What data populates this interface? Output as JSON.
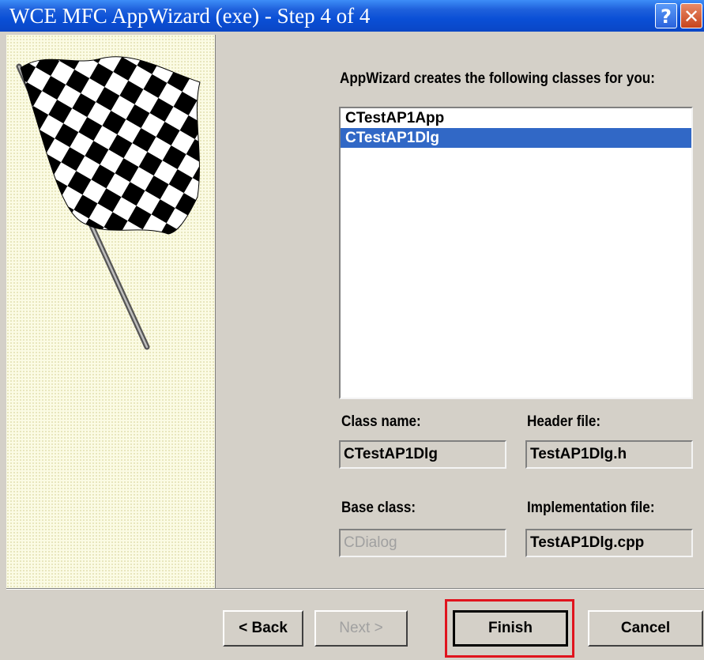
{
  "window": {
    "title": "WCE MFC AppWizard (exe) - Step 4 of 4",
    "help_glyph": "?",
    "close_glyph": "✕"
  },
  "classes": {
    "heading": "AppWizard creates the following classes for you:",
    "items": [
      {
        "label": "CTestAP1App",
        "selected": false
      },
      {
        "label": "CTestAP1Dlg",
        "selected": true
      }
    ]
  },
  "fields": {
    "class_name_label": "Class name:",
    "class_name_value": "CTestAP1Dlg",
    "header_file_label": "Header file:",
    "header_file_value": "TestAP1Dlg.h",
    "base_class_label": "Base class:",
    "base_class_value": "CDialog",
    "impl_file_label": "Implementation file:",
    "impl_file_value": "TestAP1Dlg.cpp"
  },
  "buttons": {
    "back": "< Back",
    "next": "Next >",
    "finish": "Finish",
    "cancel": "Cancel"
  },
  "colors": {
    "titlebar": "#0a4fd6",
    "selection": "#3168c6",
    "highlight_box": "#e0141e"
  }
}
